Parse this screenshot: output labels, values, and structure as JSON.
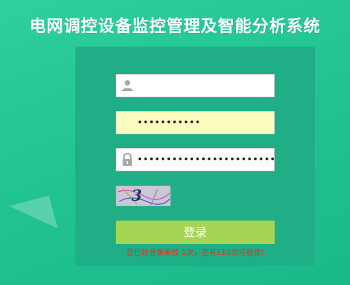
{
  "page": {
    "title": "电网调控设备监控管理及智能分析系统"
  },
  "form": {
    "username": {
      "value": "",
      "icon": "user-icon"
    },
    "secret": {
      "value": "•••••••••••"
    },
    "password": {
      "value": "•••••••••••••••••••••••••",
      "icon": "lock-icon"
    },
    "captcha": {
      "text": "3"
    },
    "login_label": "登录",
    "error_message": "您已经登录失败 1次，还有110次可登录!"
  },
  "colors": {
    "background": "#22c493",
    "panel": "#1fae86",
    "login_button": "#a5d553",
    "error_text": "#e0301e"
  }
}
